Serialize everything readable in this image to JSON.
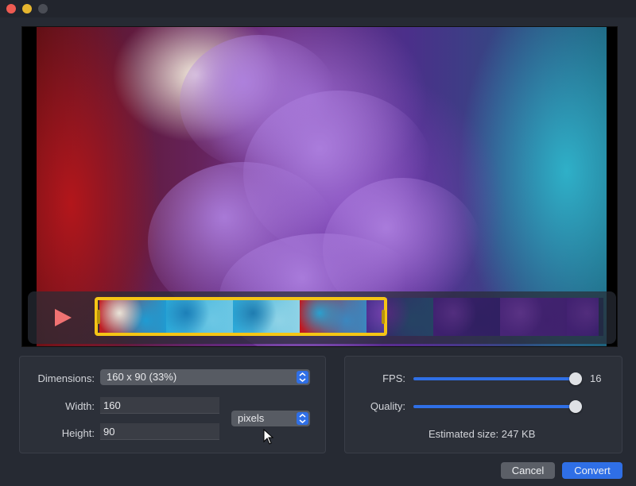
{
  "window": {
    "traffic_lights": [
      "close",
      "minimize",
      "zoom"
    ]
  },
  "preview": {
    "description_icons": [
      "smoke-video-frame"
    ]
  },
  "timeline": {
    "play_icon": "play-icon",
    "accent": "#f5c515",
    "thumbnails": [
      {
        "name": "thumb-1",
        "colors": [
          "#c21b1f",
          "#e9e4d8",
          "#1f9bd2"
        ]
      },
      {
        "name": "thumb-2",
        "colors": [
          "#2aa8d8",
          "#1c7fb8",
          "#6cc7e4"
        ]
      },
      {
        "name": "thumb-3",
        "colors": [
          "#2aa8d8",
          "#1f7cb0",
          "#8fd3e6"
        ]
      },
      {
        "name": "thumb-4",
        "colors": [
          "#c4161d",
          "#2aa0cf",
          "#3b87bf"
        ]
      },
      {
        "name": "thumb-5",
        "colors": [
          "#4b2d8e",
          "#7a40b0",
          "#2b6b86"
        ]
      },
      {
        "name": "thumb-6",
        "colors": [
          "#5a2b9a",
          "#7d44b5",
          "#3e2a80"
        ]
      },
      {
        "name": "thumb-7",
        "colors": [
          "#6a34a8",
          "#8a4cc0",
          "#5a2d96"
        ]
      },
      {
        "name": "thumb-8",
        "colors": [
          "#5e2c9c",
          "#7c42b2",
          "#44298a"
        ]
      }
    ]
  },
  "settings": {
    "dimensions_label": "Dimensions:",
    "dimensions_value": "160 x 90 (33%)",
    "width_label": "Width:",
    "width_value": "160",
    "height_label": "Height:",
    "height_value": "90",
    "unit_value": "pixels"
  },
  "output": {
    "fps_label": "FPS:",
    "fps_value": "16",
    "fps_level": 1.0,
    "quality_label": "Quality:",
    "quality_level": 1.0,
    "estimated_size": "Estimated size: 247 KB"
  },
  "buttons": {
    "cancel": "Cancel",
    "convert": "Convert"
  },
  "colors": {
    "accent": "#2f6fe6",
    "background": "#262a33"
  }
}
